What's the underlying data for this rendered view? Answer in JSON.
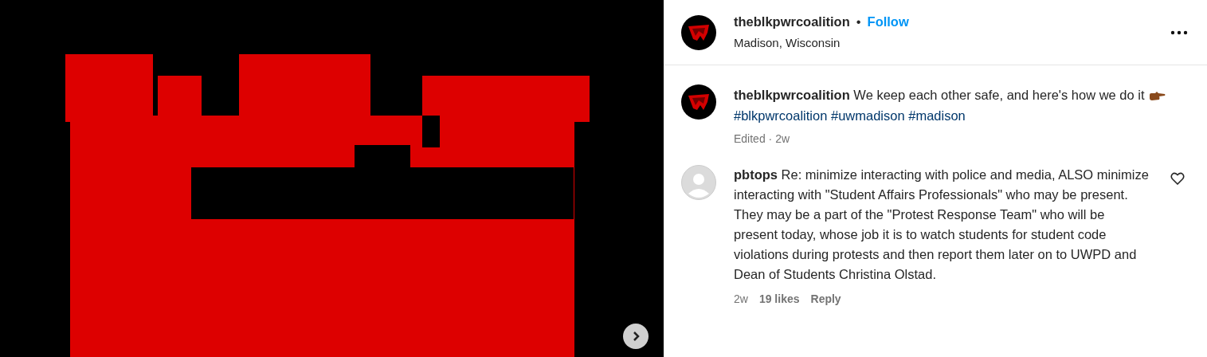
{
  "header": {
    "username": "theblkpwrcoalition",
    "separator": "•",
    "follow": "Follow",
    "location": "Madison, Wisconsin"
  },
  "caption": {
    "username": "theblkpwrcoalition",
    "text": "We keep each other safe, and here's how we do it",
    "hashtags": [
      "#blkpwrcoalition",
      "#uwmadison",
      "#madison"
    ],
    "meta": "Edited · 2w"
  },
  "comments": [
    {
      "username": "pbtops",
      "text": "Re: minimize interacting with police and media, ALSO minimize interacting with \"Student Affairs Professionals\" who may be present. They may be a part of the \"Protest Response Team\" who will be present today, whose job it is to watch students for student code violations during protests and then report them later on to UWPD and Dean of Students Christina Olstad.",
      "time": "2w",
      "likes": "19 likes",
      "reply": "Reply",
      "liked": false
    }
  ]
}
